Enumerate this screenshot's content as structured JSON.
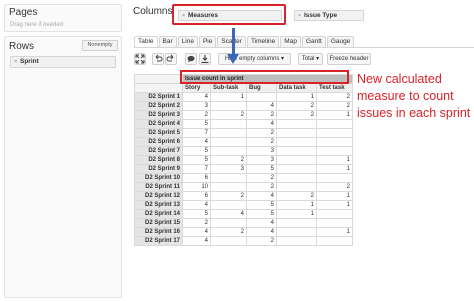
{
  "pages": {
    "title": "Pages",
    "hint": "Drag here if needed"
  },
  "rows": {
    "title": "Rows",
    "nonempty_label": "Nonempty",
    "chip": "Sprint"
  },
  "columns": {
    "title": "Columns",
    "measures_chip": "Measures",
    "issue_type_chip": "Issue Type"
  },
  "tabs": [
    "Table",
    "Bar",
    "Line",
    "Pie",
    "Scatter",
    "Timeline",
    "Map",
    "Gantt",
    "Gauge"
  ],
  "toolbar": {
    "hide_empty": "Hide empty columns",
    "total": "Total",
    "freeze": "Freeze header"
  },
  "table": {
    "measure_header": "Issue count in sprint",
    "columns": [
      "Story",
      "Sub-task",
      "Bug",
      "Data task",
      "Test task"
    ],
    "rows": [
      {
        "label": "D2 Sprint 1",
        "values": [
          "4",
          "1",
          "",
          "1",
          "2"
        ]
      },
      {
        "label": "D2 Sprint 2",
        "values": [
          "3",
          "",
          "4",
          "2",
          "2"
        ]
      },
      {
        "label": "D2 Sprint 3",
        "values": [
          "2",
          "2",
          "2",
          "2",
          "1"
        ]
      },
      {
        "label": "D2 Sprint 4",
        "values": [
          "5",
          "",
          "4",
          "",
          ""
        ]
      },
      {
        "label": "D2 Sprint 5",
        "values": [
          "7",
          "",
          "2",
          "",
          ""
        ]
      },
      {
        "label": "D2 Sprint 6",
        "values": [
          "4",
          "",
          "2",
          "",
          ""
        ]
      },
      {
        "label": "D2 Sprint 7",
        "values": [
          "5",
          "",
          "3",
          "",
          ""
        ]
      },
      {
        "label": "D2 Sprint 8",
        "values": [
          "5",
          "2",
          "3",
          "",
          "1"
        ]
      },
      {
        "label": "D2 Sprint 9",
        "values": [
          "7",
          "3",
          "5",
          "",
          "1"
        ]
      },
      {
        "label": "D2 Sprint 10",
        "values": [
          "6",
          "",
          "2",
          "",
          ""
        ]
      },
      {
        "label": "D2 Sprint 11",
        "values": [
          "10",
          "",
          "2",
          "",
          "2"
        ]
      },
      {
        "label": "D2 Sprint 12",
        "values": [
          "6",
          "2",
          "4",
          "2",
          "1"
        ]
      },
      {
        "label": "D2 Sprint 13",
        "values": [
          "4",
          "",
          "5",
          "1",
          "1"
        ]
      },
      {
        "label": "D2 Sprint 14",
        "values": [
          "5",
          "4",
          "5",
          "1",
          ""
        ]
      },
      {
        "label": "D2 Sprint 15",
        "values": [
          "2",
          "",
          "4",
          "",
          ""
        ]
      },
      {
        "label": "D2 Sprint 16",
        "values": [
          "4",
          "2",
          "4",
          "",
          "1"
        ]
      },
      {
        "label": "D2 Sprint 17",
        "values": [
          "4",
          "",
          "2",
          "",
          ""
        ]
      }
    ]
  },
  "annotation": "New calculated measure to count issues in each sprint",
  "colors": {
    "highlight": "#d8232a",
    "arrow": "#3b67b8"
  },
  "icons": [
    "expand-icon",
    "undo-icon",
    "redo-icon",
    "comment-icon",
    "download-icon"
  ]
}
